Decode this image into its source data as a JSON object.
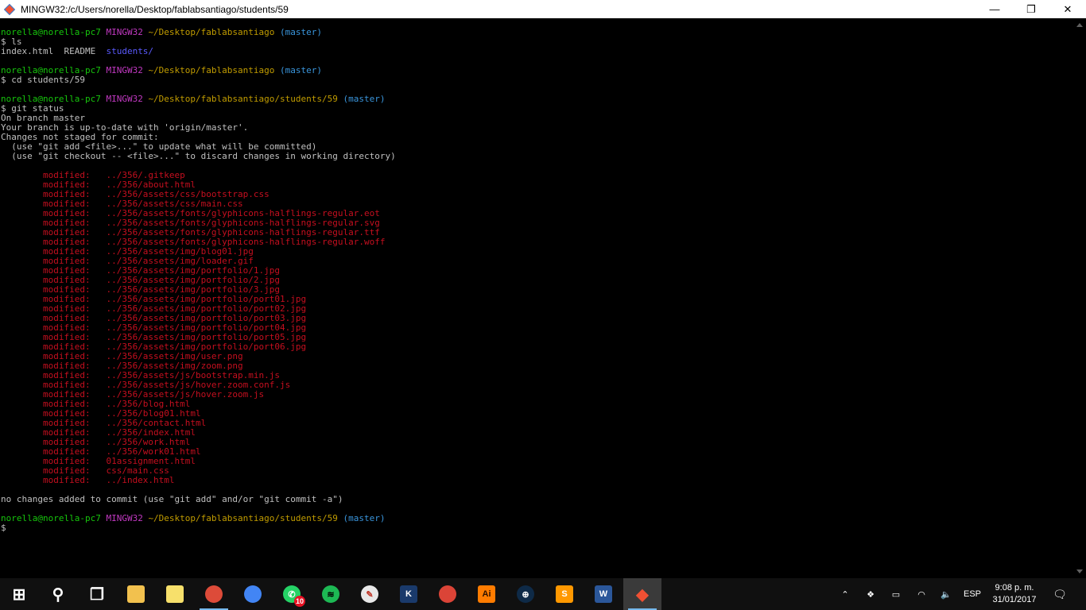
{
  "window": {
    "title": "MINGW32:/c/Users/norella/Desktop/fablabsantiago/students/59",
    "minimize_glyph": "—",
    "maximize_glyph": "❐",
    "close_glyph": "✕"
  },
  "terminal": {
    "lines": [
      [
        {
          "t": "norella@norella-pc7 ",
          "c": "green"
        },
        {
          "t": "MINGW32 ",
          "c": "magenta"
        },
        {
          "t": "~/Desktop/fablabsantiago ",
          "c": "yellow"
        },
        {
          "t": "(master)",
          "c": "cyan"
        }
      ],
      [
        {
          "t": "$ ls"
        }
      ],
      [
        {
          "t": "index.html  README  "
        },
        {
          "t": "students/",
          "c": "blue"
        }
      ],
      [],
      [
        {
          "t": "norella@norella-pc7 ",
          "c": "green"
        },
        {
          "t": "MINGW32 ",
          "c": "magenta"
        },
        {
          "t": "~/Desktop/fablabsantiago ",
          "c": "yellow"
        },
        {
          "t": "(master)",
          "c": "cyan"
        }
      ],
      [
        {
          "t": "$ cd students/59"
        }
      ],
      [],
      [
        {
          "t": "norella@norella-pc7 ",
          "c": "green"
        },
        {
          "t": "MINGW32 ",
          "c": "magenta"
        },
        {
          "t": "~/Desktop/fablabsantiago/students/59 ",
          "c": "yellow"
        },
        {
          "t": "(master)",
          "c": "cyan"
        }
      ],
      [
        {
          "t": "$ git status"
        }
      ],
      [
        {
          "t": "On branch master"
        }
      ],
      [
        {
          "t": "Your branch is up-to-date with 'origin/master'."
        }
      ],
      [
        {
          "t": "Changes not staged for commit:"
        }
      ],
      [
        {
          "t": "  (use \"git add <file>...\" to update what will be committed)"
        }
      ],
      [
        {
          "t": "  (use \"git checkout -- <file>...\" to discard changes in working directory)"
        }
      ],
      [],
      [
        {
          "t": "        modified:   ../356/.gitkeep",
          "c": "red"
        }
      ],
      [
        {
          "t": "        modified:   ../356/about.html",
          "c": "red"
        }
      ],
      [
        {
          "t": "        modified:   ../356/assets/css/bootstrap.css",
          "c": "red"
        }
      ],
      [
        {
          "t": "        modified:   ../356/assets/css/main.css",
          "c": "red"
        }
      ],
      [
        {
          "t": "        modified:   ../356/assets/fonts/glyphicons-halflings-regular.eot",
          "c": "red"
        }
      ],
      [
        {
          "t": "        modified:   ../356/assets/fonts/glyphicons-halflings-regular.svg",
          "c": "red"
        }
      ],
      [
        {
          "t": "        modified:   ../356/assets/fonts/glyphicons-halflings-regular.ttf",
          "c": "red"
        }
      ],
      [
        {
          "t": "        modified:   ../356/assets/fonts/glyphicons-halflings-regular.woff",
          "c": "red"
        }
      ],
      [
        {
          "t": "        modified:   ../356/assets/img/blog01.jpg",
          "c": "red"
        }
      ],
      [
        {
          "t": "        modified:   ../356/assets/img/loader.gif",
          "c": "red"
        }
      ],
      [
        {
          "t": "        modified:   ../356/assets/img/portfolio/1.jpg",
          "c": "red"
        }
      ],
      [
        {
          "t": "        modified:   ../356/assets/img/portfolio/2.jpg",
          "c": "red"
        }
      ],
      [
        {
          "t": "        modified:   ../356/assets/img/portfolio/3.jpg",
          "c": "red"
        }
      ],
      [
        {
          "t": "        modified:   ../356/assets/img/portfolio/port01.jpg",
          "c": "red"
        }
      ],
      [
        {
          "t": "        modified:   ../356/assets/img/portfolio/port02.jpg",
          "c": "red"
        }
      ],
      [
        {
          "t": "        modified:   ../356/assets/img/portfolio/port03.jpg",
          "c": "red"
        }
      ],
      [
        {
          "t": "        modified:   ../356/assets/img/portfolio/port04.jpg",
          "c": "red"
        }
      ],
      [
        {
          "t": "        modified:   ../356/assets/img/portfolio/port05.jpg",
          "c": "red"
        }
      ],
      [
        {
          "t": "        modified:   ../356/assets/img/portfolio/port06.jpg",
          "c": "red"
        }
      ],
      [
        {
          "t": "        modified:   ../356/assets/img/user.png",
          "c": "red"
        }
      ],
      [
        {
          "t": "        modified:   ../356/assets/img/zoom.png",
          "c": "red"
        }
      ],
      [
        {
          "t": "        modified:   ../356/assets/js/bootstrap.min.js",
          "c": "red"
        }
      ],
      [
        {
          "t": "        modified:   ../356/assets/js/hover.zoom.conf.js",
          "c": "red"
        }
      ],
      [
        {
          "t": "        modified:   ../356/assets/js/hover.zoom.js",
          "c": "red"
        }
      ],
      [
        {
          "t": "        modified:   ../356/blog.html",
          "c": "red"
        }
      ],
      [
        {
          "t": "        modified:   ../356/blog01.html",
          "c": "red"
        }
      ],
      [
        {
          "t": "        modified:   ../356/contact.html",
          "c": "red"
        }
      ],
      [
        {
          "t": "        modified:   ../356/index.html",
          "c": "red"
        }
      ],
      [
        {
          "t": "        modified:   ../356/work.html",
          "c": "red"
        }
      ],
      [
        {
          "t": "        modified:   ../356/work01.html",
          "c": "red"
        }
      ],
      [
        {
          "t": "        modified:   01assignment.html",
          "c": "red"
        }
      ],
      [
        {
          "t": "        modified:   css/main.css",
          "c": "red"
        }
      ],
      [
        {
          "t": "        modified:   ../index.html",
          "c": "red"
        }
      ],
      [],
      [
        {
          "t": "no changes added to commit (use \"git add\" and/or \"git commit -a\")"
        }
      ],
      [],
      [
        {
          "t": "norella@norella-pc7 ",
          "c": "green"
        },
        {
          "t": "MINGW32 ",
          "c": "magenta"
        },
        {
          "t": "~/Desktop/fablabsantiago/students/59 ",
          "c": "yellow"
        },
        {
          "t": "(master)",
          "c": "cyan"
        }
      ],
      [
        {
          "t": "$"
        }
      ]
    ]
  },
  "taskbar": {
    "items": [
      {
        "name": "start-button",
        "icon": "windows-icon",
        "glyph": "⊞",
        "bg": "transparent",
        "fg": "#ffffff",
        "shape": "plain"
      },
      {
        "name": "search-button",
        "icon": "search-icon",
        "glyph": "⚲",
        "bg": "transparent",
        "fg": "#ffffff",
        "shape": "plain"
      },
      {
        "name": "task-view-button",
        "icon": "task-view-icon",
        "glyph": "❐",
        "bg": "transparent",
        "fg": "#ffffff",
        "shape": "plain"
      },
      {
        "name": "file-explorer-button",
        "icon": "folder-icon",
        "glyph": "",
        "bg": "#f2c14e",
        "fg": "#ffffff",
        "shape": "square"
      },
      {
        "name": "sticky-notes-button",
        "icon": "sticky-notes-icon",
        "glyph": "",
        "bg": "#f7e06b",
        "fg": "#ffffff",
        "shape": "square"
      },
      {
        "name": "chrome-profile-button",
        "icon": "chrome-icon",
        "glyph": "",
        "bg": "#dd4b39",
        "fg": "#ffffff",
        "shape": "round",
        "running": true
      },
      {
        "name": "chrome-profile-2-button",
        "icon": "chrome-icon",
        "glyph": "",
        "bg": "#4285f4",
        "fg": "#ffffff",
        "shape": "round"
      },
      {
        "name": "whatsapp-button",
        "icon": "whatsapp-icon",
        "glyph": "✆",
        "bg": "#25d366",
        "fg": "#ffffff",
        "shape": "round",
        "badge": "10"
      },
      {
        "name": "spotify-button",
        "icon": "spotify-icon",
        "glyph": "≋",
        "bg": "#1db954",
        "fg": "#000000",
        "shape": "round"
      },
      {
        "name": "paint-button",
        "icon": "paint-icon",
        "glyph": "✎",
        "bg": "#e8e8e8",
        "fg": "#c0392b",
        "shape": "round"
      },
      {
        "name": "kindle-button",
        "icon": "kindle-icon",
        "glyph": "K",
        "bg": "#1a3a6b",
        "fg": "#ffffff",
        "shape": "square"
      },
      {
        "name": "chrome-button",
        "icon": "chrome-icon",
        "glyph": "",
        "bg": "#db4437",
        "fg": "#ffffff",
        "shape": "round"
      },
      {
        "name": "illustrator-button",
        "icon": "illustrator-icon",
        "glyph": "Ai",
        "bg": "#ff7c00",
        "fg": "#2b1100",
        "shape": "square"
      },
      {
        "name": "network-app-button",
        "icon": "globe-icon",
        "glyph": "⊕",
        "bg": "#0e2a47",
        "fg": "#ffffff",
        "shape": "round"
      },
      {
        "name": "sublime-text-button",
        "icon": "sublime-text-icon",
        "glyph": "S",
        "bg": "#ff9800",
        "fg": "#ffffff",
        "shape": "square"
      },
      {
        "name": "word-button",
        "icon": "word-icon",
        "glyph": "W",
        "bg": "#2b579a",
        "fg": "#ffffff",
        "shape": "square"
      },
      {
        "name": "git-bash-button",
        "icon": "git-bash-icon",
        "glyph": "◆",
        "bg": "transparent",
        "fg": "#f05033",
        "shape": "plain",
        "active": true
      }
    ],
    "tray": {
      "chevron": "⌃",
      "dropbox": "❖",
      "battery": "▭",
      "wifi": "◠",
      "volume": "🔈",
      "language": "ESP",
      "notifications": "🗨"
    },
    "clock": {
      "time": "9:08 p. m.",
      "date": "31/01/2017"
    }
  }
}
